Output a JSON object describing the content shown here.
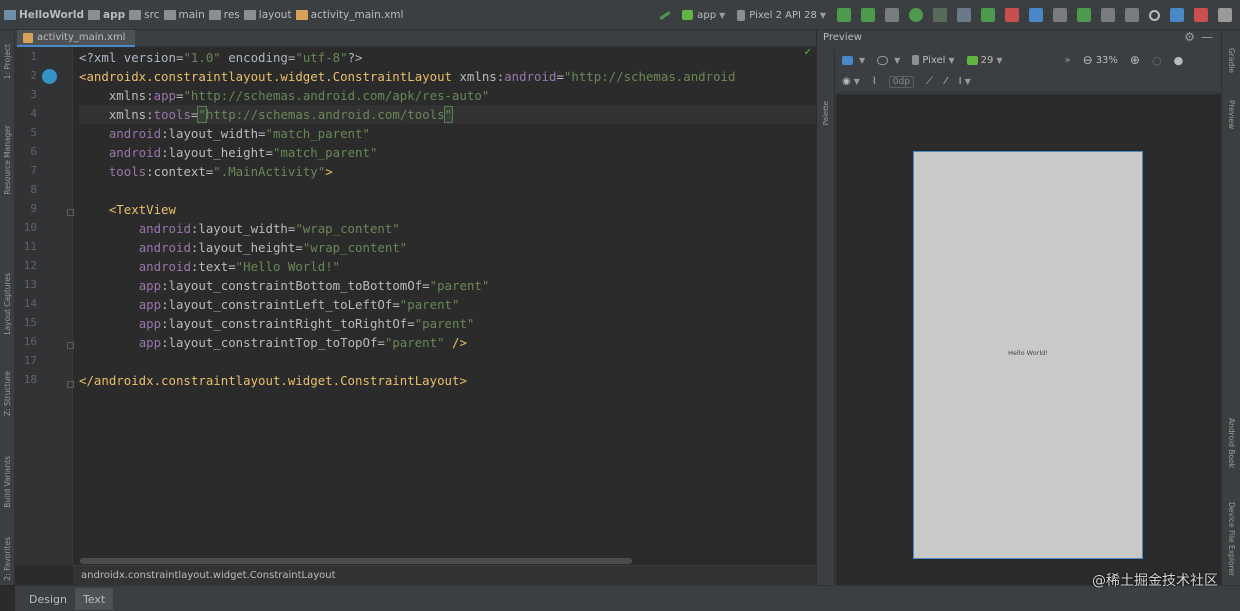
{
  "navbar": {
    "crumbs": [
      "HelloWorld",
      "app",
      "src",
      "main",
      "res",
      "layout",
      "activity_main.xml"
    ],
    "run_config": "app",
    "device": "Pixel 2 API 28"
  },
  "left_tools": [
    "1: Project",
    "Resource Manager",
    "Layout Captures",
    "Z: Structure",
    "Build Variants",
    "2: Favorites"
  ],
  "editor": {
    "tab_label": "activity_main.xml",
    "line_numbers": [
      "1",
      "2",
      "3",
      "4",
      "5",
      "6",
      "7",
      "8",
      "9",
      "10",
      "11",
      "12",
      "13",
      "14",
      "15",
      "16",
      "17",
      "18"
    ],
    "breadcrumb": "androidx.constraintlayout.widget.ConstraintLayout"
  },
  "code": {
    "l1": {
      "a": "<?xml version=",
      "b": "\"1.0\"",
      "c": " encoding=",
      "d": "\"utf-8\"",
      "e": "?>"
    },
    "l2": {
      "a": "<androidx.constraintlayout.widget.ConstraintLayout ",
      "b": "xmlns:",
      "c": "android",
      "d": "=",
      "e": "\"http://schemas.android"
    },
    "l3": {
      "a": "xmlns:",
      "b": "app",
      "c": "=",
      "d": "\"http://schemas.android.com/apk/res-auto\""
    },
    "l4": {
      "a": "xmlns:",
      "b": "tools",
      "c": "=",
      "d": "\"",
      "e": "http://schemas.android.com/tools",
      "f": "\""
    },
    "l5": {
      "a": "android",
      "b": ":layout_width=",
      "c": "\"match_parent\""
    },
    "l6": {
      "a": "android",
      "b": ":layout_height=",
      "c": "\"match_parent\""
    },
    "l7": {
      "a": "tools",
      "b": ":context=",
      "c": "\".MainActivity\"",
      "d": ">"
    },
    "l9": {
      "a": "<TextView"
    },
    "l10": {
      "a": "android",
      "b": ":layout_width=",
      "c": "\"wrap_content\""
    },
    "l11": {
      "a": "android",
      "b": ":layout_height=",
      "c": "\"wrap_content\""
    },
    "l12": {
      "a": "android",
      "b": ":text=",
      "c": "\"Hello World!\""
    },
    "l13": {
      "a": "app",
      "b": ":layout_constraintBottom_toBottomOf=",
      "c": "\"parent\""
    },
    "l14": {
      "a": "app",
      "b": ":layout_constraintLeft_toLeftOf=",
      "c": "\"parent\""
    },
    "l15": {
      "a": "app",
      "b": ":layout_constraintRight_toRightOf=",
      "c": "\"parent\""
    },
    "l16": {
      "a": "app",
      "b": ":layout_constraintTop_toTopOf=",
      "c": "\"parent\"",
      "d": " />"
    },
    "l18": {
      "a": "</androidx.constraintlayout.widget.ConstraintLayout>"
    }
  },
  "bottom_tabs": {
    "design": "Design",
    "text": "Text"
  },
  "preview": {
    "title": "Preview",
    "palette_label": "Palette",
    "device": "Pixel",
    "api": "29",
    "zoom": "33%",
    "margin": "0dp",
    "device_text": "Hello World!"
  },
  "right_tools": [
    "Gradle",
    "Preview",
    "Android Book",
    "Device File Explorer"
  ],
  "watermark": "@稀土掘金技术社区",
  "colors": {
    "background": "#2b2b2b",
    "panel": "#3c3f41",
    "tag": "#e8bf6a",
    "namespace": "#9876aa",
    "string": "#6a8759",
    "accent": "#4a88c7"
  }
}
